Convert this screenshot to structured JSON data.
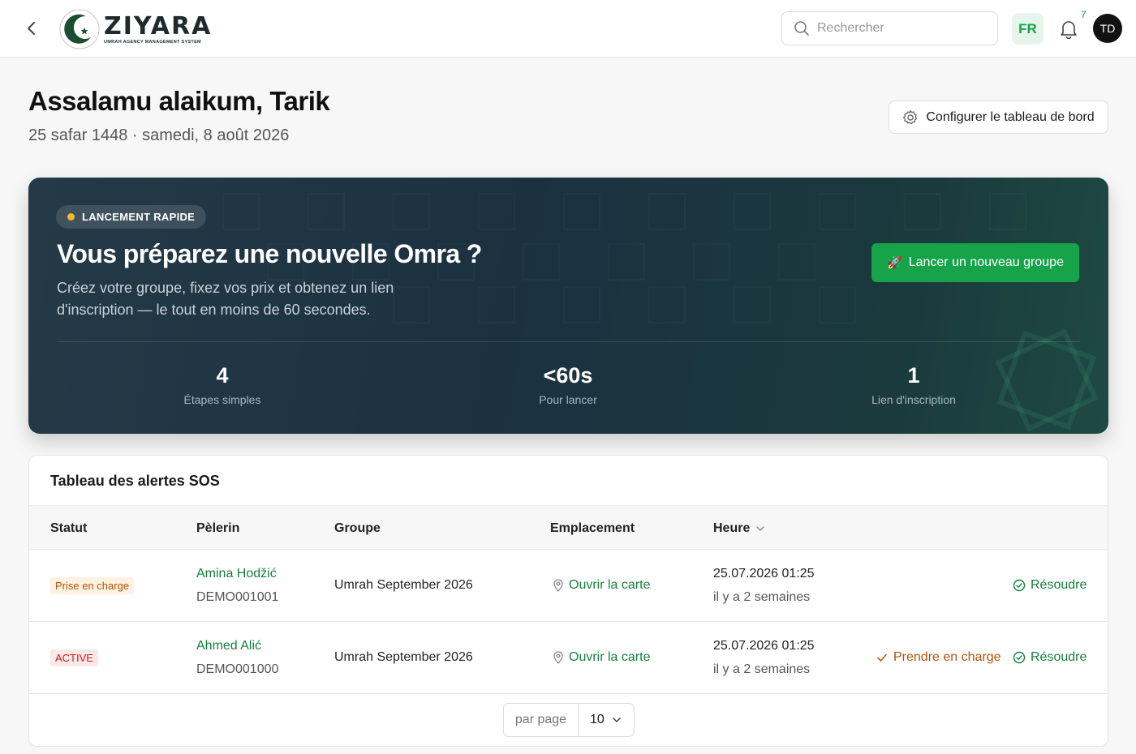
{
  "app": {
    "logo_name": "ZIYARA",
    "logo_tagline": "UMRAH AGENCY MANAGEMENT SYSTEM"
  },
  "header": {
    "search_placeholder": "Rechercher",
    "language": "FR",
    "notification_count": "7",
    "avatar_initials": "TD"
  },
  "greeting": {
    "title": "Assalamu alaikum, Tarik",
    "date": "25 safar 1448 · samedi, 8 août 2026",
    "configure_label": "Configurer le tableau de bord"
  },
  "hero": {
    "badge": "LANCEMENT RAPIDE",
    "title": "Vous préparez une nouvelle Omra ?",
    "description": "Créez votre groupe, fixez vos prix et obtenez un lien d'inscription — le tout en moins de 60 secondes.",
    "button_label": "Lancer un nouveau groupe",
    "stats": [
      {
        "value": "4",
        "label": "Étapes simples"
      },
      {
        "value": "<60s",
        "label": "Pour lancer"
      },
      {
        "value": "1",
        "label": "Lien d'inscription"
      }
    ]
  },
  "sos": {
    "title": "Tableau des alertes SOS",
    "columns": {
      "status": "Statut",
      "pilgrim": "Pèlerin",
      "group": "Groupe",
      "location": "Emplacement",
      "time": "Heure"
    },
    "rows": [
      {
        "status": "Prise en charge",
        "name": "Amina Hodžić",
        "id": "DEMO001001",
        "group": "Umrah September 2026",
        "location": "Ouvrir la carte",
        "time": "25.07.2026 01:25",
        "ago": "il y a 2 semaines",
        "resolve": "Résoudre"
      },
      {
        "status": "ACTIVE",
        "name": "Ahmed Alić",
        "id": "DEMO001000",
        "group": "Umrah September 2026",
        "location": "Ouvrir la carte",
        "time": "25.07.2026 01:25",
        "ago": "il y a 2 semaines",
        "take": "Prendre en charge",
        "resolve": "Résoudre"
      }
    ],
    "pagination": {
      "label": "par page",
      "value": "10"
    }
  },
  "colors": {
    "brand_green": "#16a34a",
    "hero_dark": "#1b3140",
    "warning_amber": "#b45309",
    "danger_red": "#c81e1e"
  }
}
